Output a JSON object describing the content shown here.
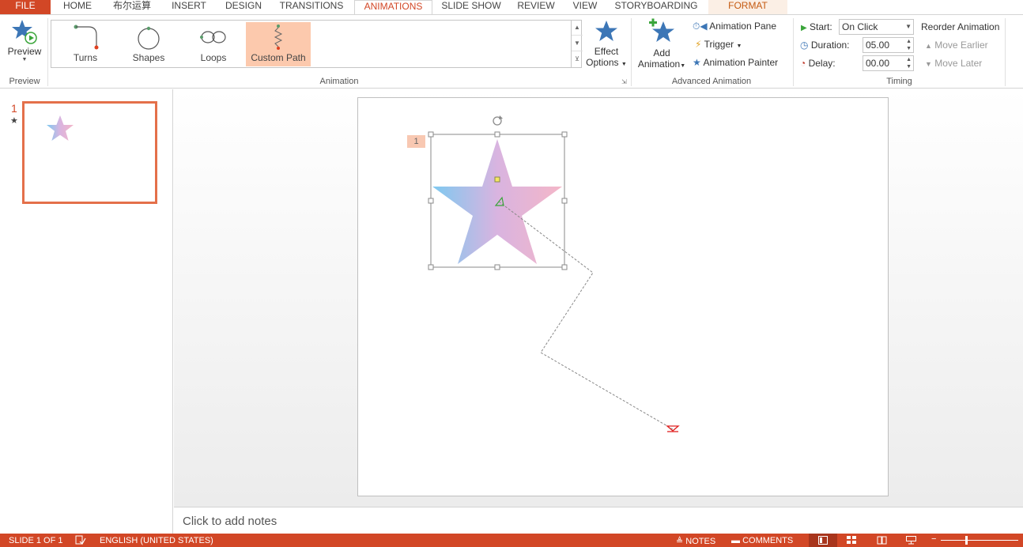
{
  "tabs": [
    "FILE",
    "HOME",
    "布尔运算",
    "INSERT",
    "DESIGN",
    "TRANSITIONS",
    "ANIMATIONS",
    "SLIDE SHOW",
    "REVIEW",
    "VIEW",
    "STORYBOARDING",
    "FORMAT"
  ],
  "active_tab": "ANIMATIONS",
  "ribbon": {
    "preview": {
      "label": "Preview",
      "group": "Preview"
    },
    "gallery": {
      "items": [
        "Turns",
        "Shapes",
        "Loops",
        "Custom Path"
      ],
      "selected": "Custom Path"
    },
    "effect_options": {
      "line1": "Effect",
      "line2": "Options"
    },
    "animation_group": "Animation",
    "add_animation": {
      "line1": "Add",
      "line2": "Animation"
    },
    "advanced": {
      "animation_pane": "Animation Pane",
      "trigger": "Trigger",
      "animation_painter": "Animation Painter",
      "group": "Advanced Animation"
    },
    "timing": {
      "start_label": "Start:",
      "start_value": "On Click",
      "duration_label": "Duration:",
      "duration_value": "05.00",
      "delay_label": "Delay:",
      "delay_value": "00.00",
      "reorder": "Reorder Animation",
      "move_earlier": "Move Earlier",
      "move_later": "Move Later",
      "group": "Timing"
    }
  },
  "thumbnails": {
    "slide_number": "1",
    "star_marker": "★"
  },
  "slide": {
    "anim_number": "1"
  },
  "notes": {
    "placeholder": "Click to add notes"
  },
  "status": {
    "slide_info": "SLIDE 1 OF 1",
    "language": "ENGLISH (UNITED STATES)",
    "notes": "NOTES",
    "comments": "COMMENTS"
  },
  "colors": {
    "accent": "#d24726",
    "star_blue": "#7ec9f0",
    "star_pink": "#f4b6c8",
    "path_start": "#3aa53a",
    "path_end": "#e02020"
  }
}
